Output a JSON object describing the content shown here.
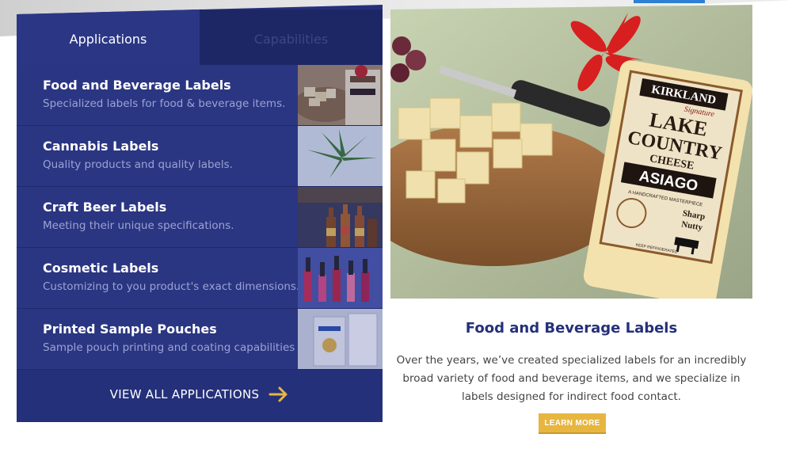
{
  "tabs": {
    "applications": "Applications",
    "capabilities": "Capabilities"
  },
  "items": [
    {
      "title": "Food and Beverage Labels",
      "desc": "Specialized labels for food & beverage items.",
      "thumb": "cheese-icon"
    },
    {
      "title": "Cannabis Labels",
      "desc": "Quality products and quality labels.",
      "thumb": "leaf-icon"
    },
    {
      "title": "Craft Beer Labels",
      "desc": "Meeting their unique specifications.",
      "thumb": "bottles-icon"
    },
    {
      "title": "Cosmetic Labels",
      "desc": "Customizing to you product's exact dimensions.",
      "thumb": "nail-polish-icon"
    },
    {
      "title": "Printed Sample Pouches",
      "desc": "Sample pouch printing and coating capabilities",
      "thumb": "pouch-icon"
    }
  ],
  "view_all": "VIEW ALL APPLICATIONS",
  "feature": {
    "title": "Food and Beverage Labels",
    "text": "Over the years, we’ve created specialized labels for an incredibly broad variety of food and beverage items, and we specialize in labels designed for indirect food contact.",
    "button": "LEARN MORE",
    "label": {
      "brand": "KIRKLAND",
      "brand_sub": "Signature",
      "line1": "LAKE",
      "line2": "COUNTRY",
      "line3": "CHEESE",
      "variety": "ASIAGO",
      "tagline": "A HANDCRAFTED MASTERPIECE",
      "flavor1": "Sharp",
      "flavor2": "Nutty",
      "note": "KEEP REFRIGERATED"
    }
  },
  "colors": {
    "panel": "#25307a",
    "accent": "#e7b641",
    "title": "#25307a"
  }
}
